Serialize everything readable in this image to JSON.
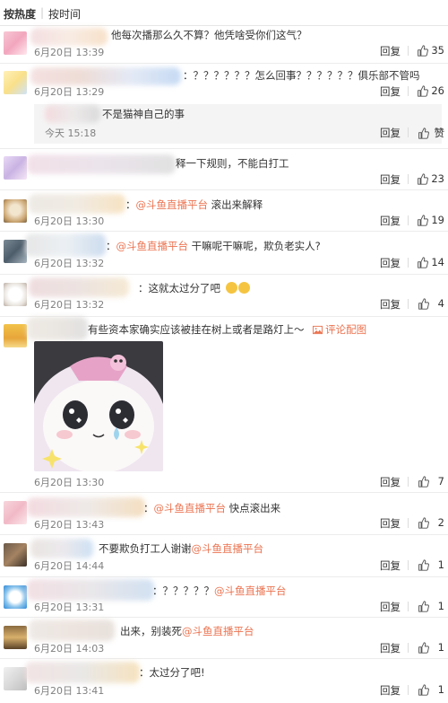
{
  "sort": {
    "hot_label": "按热度",
    "time_label": "按时间"
  },
  "actions": {
    "reply_label": "回复",
    "zan_label": "赞"
  },
  "comments": [
    {
      "text": "他每次播那么久不算？他凭啥受你们这气？",
      "time": "6月20日 13:39",
      "likes": "35"
    },
    {
      "text": "：？？？？？？怎么回事？？？？？？俱乐部不管吗",
      "time": "6月20日 13:29",
      "likes": "26",
      "reply": {
        "text": "不是猫神自己的事",
        "time": "今天 15:18"
      }
    },
    {
      "text": "释一下规则，不能白打工",
      "time": "6月20日 13:30",
      "likes": "23"
    },
    {
      "prefix": "：",
      "mention": "@斗鱼直播平台",
      "text": " 滚出来解释",
      "time": "6月20日 13:30",
      "likes": "19"
    },
    {
      "prefix": "：",
      "mention": "@斗鱼直播平台",
      "text": " 干嘛呢干嘛呢，欺负老实人?",
      "time": "6月20日 13:32",
      "likes": "14"
    },
    {
      "text": "：这就太过分了吧",
      "time": "6月20日 13:32",
      "likes": "4"
    },
    {
      "text": "有些资本家确实应该被挂在树上或者是路灯上～",
      "link": "评论配图",
      "time": "6月20日 13:30",
      "likes": "7"
    },
    {
      "prefix": "：",
      "mention": "@斗鱼直播平台",
      "text": " 快点滚出来",
      "time": "6月20日 13:43",
      "likes": "2"
    },
    {
      "text": "不要欺负打工人谢谢",
      "mention": "@斗鱼直播平台",
      "time": "6月20日 14:44",
      "likes": "1"
    },
    {
      "prefix": "：？？？？？",
      "mention": "@斗鱼直播平台",
      "time": "6月20日 13:31",
      "likes": "1"
    },
    {
      "text": "出来，别装死",
      "mention": "@斗鱼直播平台",
      "time": "6月20日 14:03",
      "likes": "1"
    },
    {
      "text": "：太过分了吧!",
      "time": "6月20日 13:41",
      "likes": "1"
    }
  ],
  "colors": {
    "mention": "#eb7350",
    "meta": "#808080",
    "divider": "#ececec",
    "reply_bg": "#f4f4f4"
  }
}
